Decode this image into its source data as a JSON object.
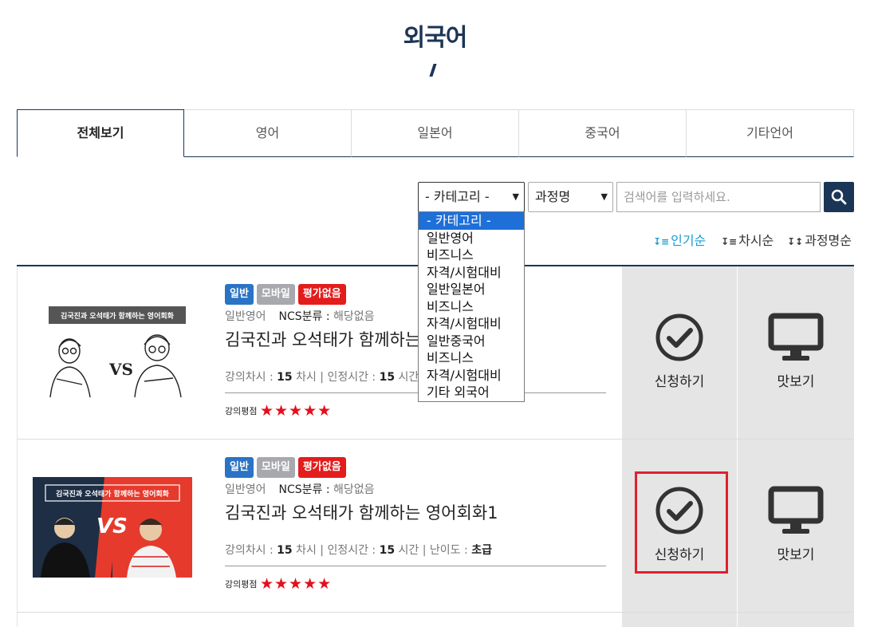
{
  "header": {
    "title": "외국어"
  },
  "tabs": [
    {
      "label": "전체보기",
      "active": true
    },
    {
      "label": "영어"
    },
    {
      "label": "일본어"
    },
    {
      "label": "중국어"
    },
    {
      "label": "기타언어"
    }
  ],
  "search": {
    "category_selected": "- 카테고리 -",
    "field_selected": "과정명",
    "placeholder": "검색어를 입력하세요."
  },
  "category_options": [
    "- 카테고리 -",
    "일반영어",
    "비즈니스",
    "자격/시험대비",
    "일반일본어",
    "비즈니스",
    "자격/시험대비",
    "일반중국어",
    "비즈니스",
    "자격/시험대비",
    "기타 외국어"
  ],
  "sort": [
    {
      "label": "인기순",
      "icon": "sort-desc-icon",
      "active": true
    },
    {
      "label": "차시순",
      "icon": "sort-desc-icon"
    },
    {
      "label": "과정명순",
      "icon": "sort-az-icon"
    }
  ],
  "courses": [
    {
      "badges": [
        "일반",
        "모바일",
        "평가없음"
      ],
      "category": "일반영어",
      "ncs_label": "NCS분류 :",
      "ncs_value": "해당없음",
      "name": "김국진과 오석태가 함께하는 영어회화",
      "lessons_label": "강의차시 :",
      "lessons": "15",
      "lessons_unit": "차시 | 인정시간 :",
      "hours": "15",
      "hours_unit": "시간",
      "rating_label": "강의평점",
      "stars": "★★★★★",
      "thumb_text": "김국진과 오석태가 함께하는 영어회화",
      "apply_label": "신청하기",
      "preview_label": "맛보기"
    },
    {
      "badges": [
        "일반",
        "모바일",
        "평가없음"
      ],
      "category": "일반영어",
      "ncs_label": "NCS분류 :",
      "ncs_value": "해당없음",
      "name": "김국진과 오석태가 함께하는 영어회화1",
      "lessons_label": "강의차시 :",
      "lessons": "15",
      "lessons_unit": "차시 | 인정시간 :",
      "hours": "15",
      "hours_unit": "시간 | 난이도 :",
      "level": "초급",
      "rating_label": "강의평점",
      "stars": "★★★★★",
      "thumb_text": "김국진과 오석태가 함께하는 영어회화",
      "apply_label": "신청하기",
      "preview_label": "맛보기"
    }
  ],
  "colors": {
    "brand": "#1b3556",
    "accent": "#1a9cd1",
    "highlight": "#e0202a"
  }
}
